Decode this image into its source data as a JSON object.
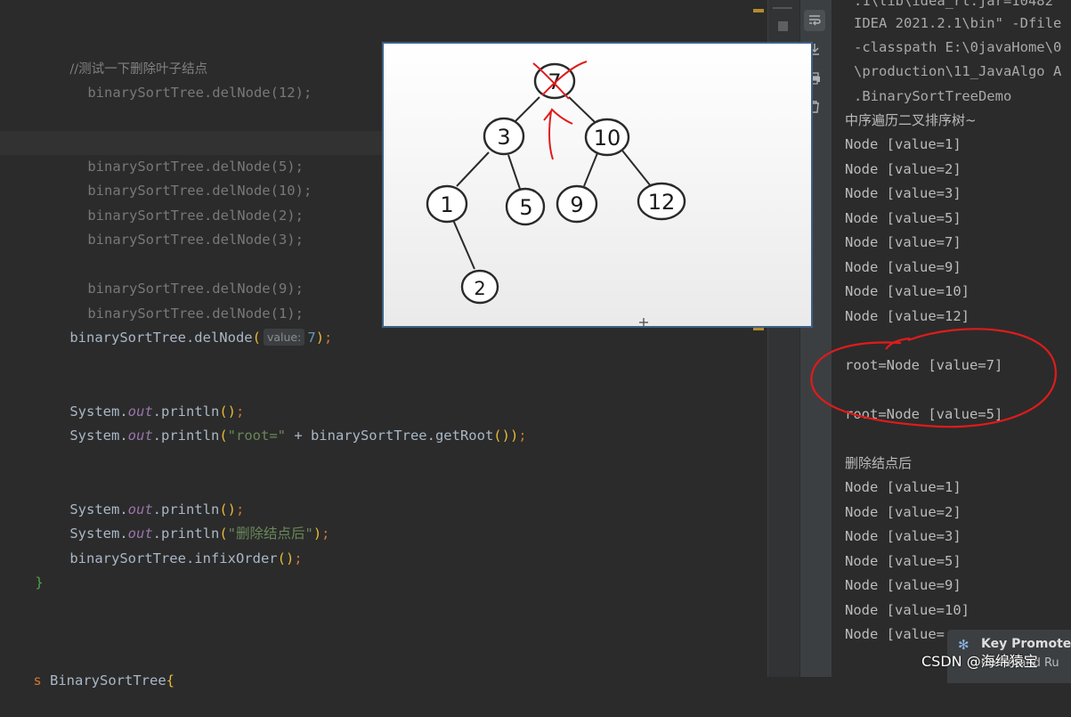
{
  "editor": {
    "lines": {
      "comment_test": "//测试一下删除叶子结点",
      "del12": "binarySortTree.delNode(12);",
      "del5": "binarySortTree.delNode(5);",
      "del10": "binarySortTree.delNode(10);",
      "del2": "binarySortTree.delNode(2);",
      "del3": "binarySortTree.delNode(3);",
      "del9": "binarySortTree.delNode(9);",
      "del1": "binarySortTree.delNode(1);",
      "del7_prefix": "binarySortTree.delNode",
      "del7_hint": "value:",
      "del7_arg": "7",
      "println_sys": "System.",
      "println_out": "out",
      "println_call": ".println",
      "root_string": "\"root=\"",
      "root_rest": " + binarySortTree.getRoot",
      "deleted_string": "\"删除结点后\"",
      "infix": "binarySortTree.infixOrder",
      "close_brace": "}",
      "class_kw": "s",
      "class_name": " BinarySortTree"
    }
  },
  "console": {
    "cmd_lines": [
      ".1\\lib\\idea_rt.jar=10482",
      "IDEA 2021.2.1\\bin\" -Dfile",
      "-classpath E:\\0javaHome\\0",
      "\\production\\11_JavaAlgo A",
      ".BinarySortTreeDemo"
    ],
    "infix_title": "中序遍历二叉排序树~",
    "first_nodes": [
      "Node [value=1]",
      "Node [value=2]",
      "Node [value=3]",
      "Node [value=5]",
      "Node [value=7]",
      "Node [value=9]",
      "Node [value=10]",
      "Node [value=12]"
    ],
    "root_before": "root=Node [value=7]",
    "root_after": "root=Node [value=5]",
    "after_title": "删除结点后",
    "second_nodes": [
      "Node [value=1]",
      "Node [value=2]",
      "Node [value=3]",
      "Node [value=5]",
      "Node [value=9]",
      "Node [value=10]",
      "Node [value="
    ]
  },
  "tree_image": {
    "nodes": [
      "7",
      "3",
      "10",
      "1",
      "5",
      "9",
      "12",
      "2"
    ]
  },
  "key_promoter": {
    "title": "Key Promoter",
    "subtitle": "Command Ru"
  },
  "watermark": "CSDN @海绵猿宝",
  "icons": {
    "wrap": "soft-wrap-icon",
    "scroll": "scroll-to-end-icon",
    "print": "print-icon",
    "trash": "trash-icon",
    "stop": "stop-icon"
  },
  "colors": {
    "editor_bg": "#2b2b2b",
    "annotation_red": "#e01b1b",
    "string_green": "#6a8759",
    "field_purple": "#9876aa"
  }
}
